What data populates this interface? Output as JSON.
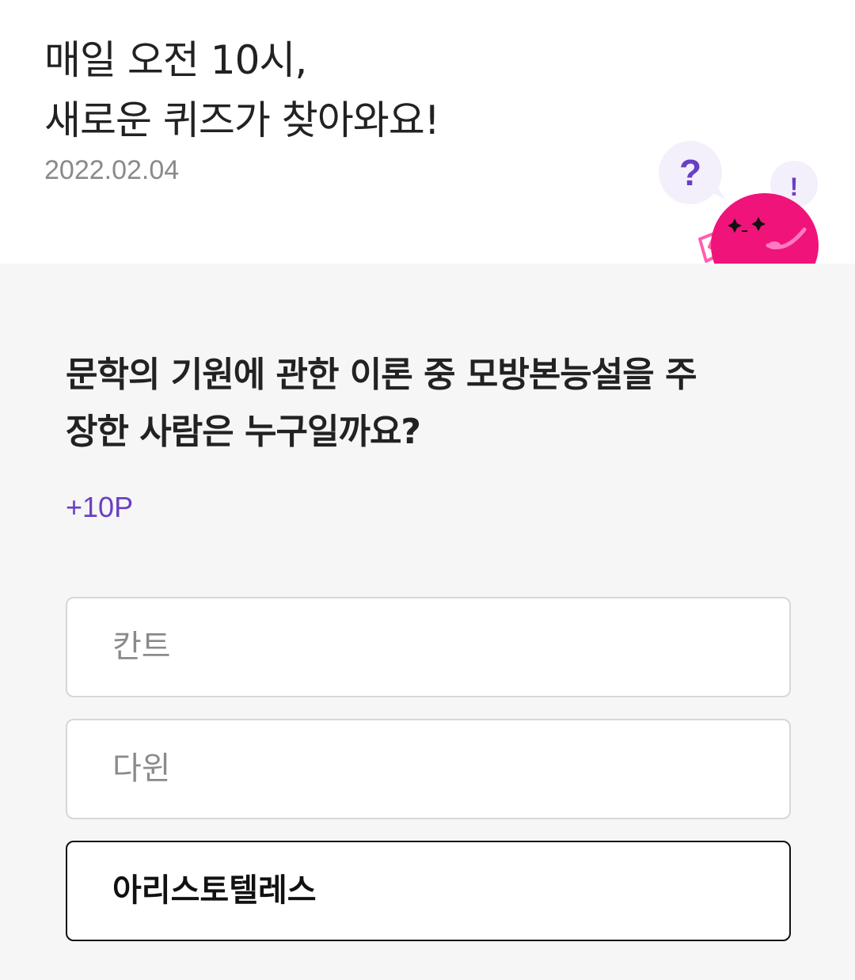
{
  "header": {
    "title_line1": "매일 오전 10시,",
    "title_line2": "새로운 퀴즈가 찾아와요!",
    "date": "2022.02.04",
    "mascot": {
      "icon": "pink-blob-mascot-icon",
      "bubble_question": "?",
      "bubble_exclaim": "!",
      "body_color": "#f0137a",
      "bubble_color": "#f3f0fb",
      "accent_color": "#6a3fc4"
    }
  },
  "quiz": {
    "question_line1": "문학의 기원에 관한 이론 중 모방본능설을 주",
    "question_line2": "장한 사람은 누구일까요?",
    "points": "+10P",
    "options": [
      {
        "label": "칸트",
        "selected": false
      },
      {
        "label": "다윈",
        "selected": false
      },
      {
        "label": "아리스토텔레스",
        "selected": true
      }
    ]
  },
  "colors": {
    "accent": "#6a3fc4",
    "background": "#f6f6f6",
    "card": "#ffffff"
  }
}
